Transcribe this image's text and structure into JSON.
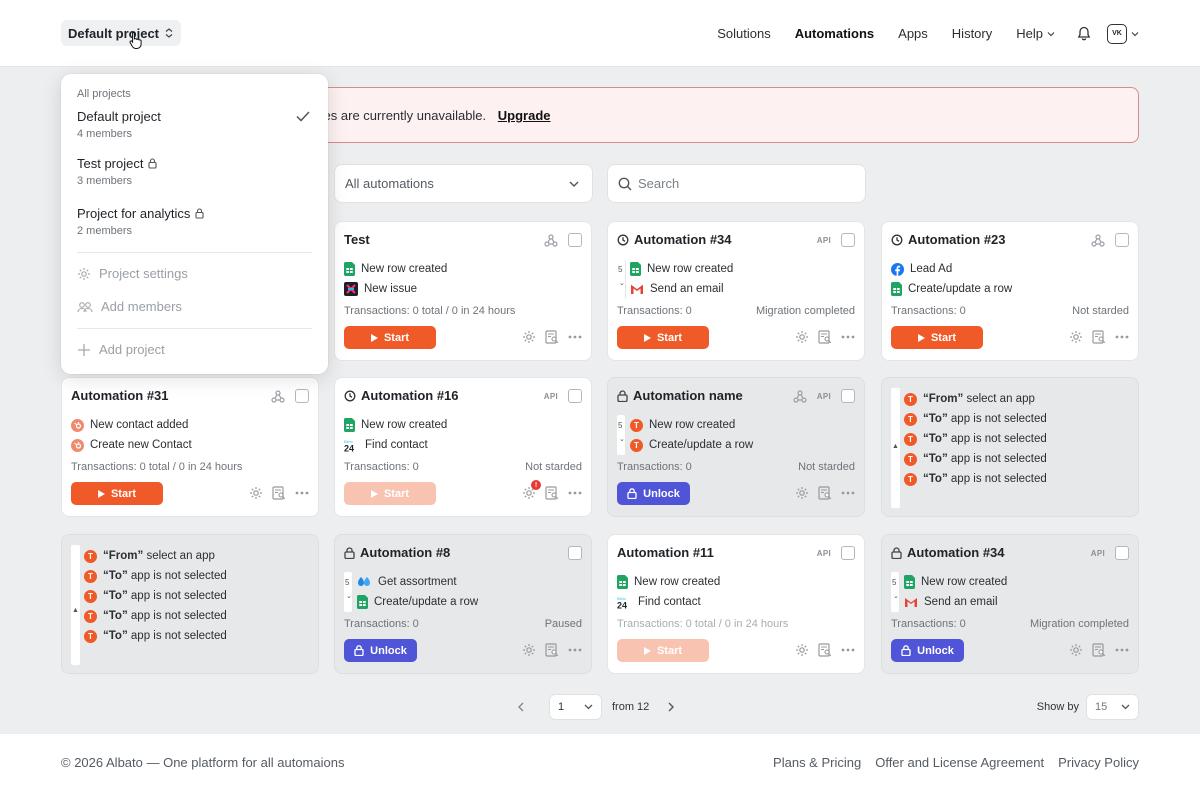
{
  "header": {
    "project_label": "Default project",
    "nav": [
      "Solutions",
      "Automations",
      "Apps",
      "History",
      "Help"
    ],
    "avatar_initials": "VK"
  },
  "banner": {
    "text": "ures are currently unavailable.",
    "link": "Upgrade"
  },
  "filters": {
    "select_value": "All automations",
    "search_placeholder": "Search"
  },
  "dropdown": {
    "heading": "All projects",
    "projects": [
      {
        "name": "Default project",
        "members": "4 members",
        "selected": true
      },
      {
        "name": "Test project",
        "members": "3 members",
        "locked": true
      },
      {
        "name": "Project for analytics",
        "members": "2 members",
        "locked": true
      }
    ],
    "settings": "Project settings",
    "add_members": "Add members",
    "add_project": "Add project"
  },
  "labels": {
    "start": "Start",
    "unlock": "Unlock",
    "api": "API",
    "from_prefix": "“From”",
    "from_rest": " select an app",
    "to_prefix": "“To”",
    "to_rest": " app is not selected"
  },
  "cards": {
    "test": {
      "title": "Test",
      "step1": "New row created",
      "step2": "New issue",
      "tx": "Transactions: 0 total / 0 in 24 hours"
    },
    "a34": {
      "title": "Automation #34",
      "step1": "New row created",
      "step2": "Send an email",
      "tx": "Transactions: 0",
      "status": "Migration completed",
      "counter": "5"
    },
    "a23": {
      "title": "Automation #23",
      "step1": "Lead Ad",
      "step2": "Create/update a row",
      "tx": "Transactions: 0",
      "status": "Not starded"
    },
    "a31": {
      "title": "Automation #31",
      "step1": "New contact added",
      "step2": "Create new Contact",
      "tx": "Transactions: 0 total / 0 in 24 hours"
    },
    "a16": {
      "title": "Automation #16",
      "step1": "New row created",
      "step2": "Find contact",
      "tx": "Transactions: 0",
      "status": "Not starded",
      "badge": "!"
    },
    "aname": {
      "title": "Automation name",
      "step1": "New row created",
      "step2": "Create/update a row",
      "tx": "Transactions: 0",
      "status": "Not starded",
      "counter": "5"
    },
    "a8": {
      "title": "Automation #8",
      "step1": "Get assortment",
      "step2": "Create/update a row",
      "tx": "Transactions: 0",
      "status": "Paused",
      "counter": "5"
    },
    "a11": {
      "title": "Automation #11",
      "step1": "New row created",
      "step2": "Find contact",
      "tx": "Transactions: 0 total / 0 in 24 hours"
    },
    "a34b": {
      "title": "Automation #34",
      "step1": "New row created",
      "step2": "Send an email",
      "tx": "Transactions: 0",
      "status": "Migration completed",
      "counter": "5"
    }
  },
  "pagination": {
    "page": "1",
    "from_text": "from 12",
    "show_by_label": "Show by",
    "show_by_value": "15"
  },
  "footer": {
    "copyright": "© 2026 Albato — One platform for all automaions",
    "links": [
      "Plans & Pricing",
      "Offer and License Agreement",
      "Privacy Policy"
    ]
  },
  "colors": {
    "accent_orange": "#f05a28",
    "unlock_purple": "#4f55d6",
    "banner_border": "#d98b8b"
  }
}
